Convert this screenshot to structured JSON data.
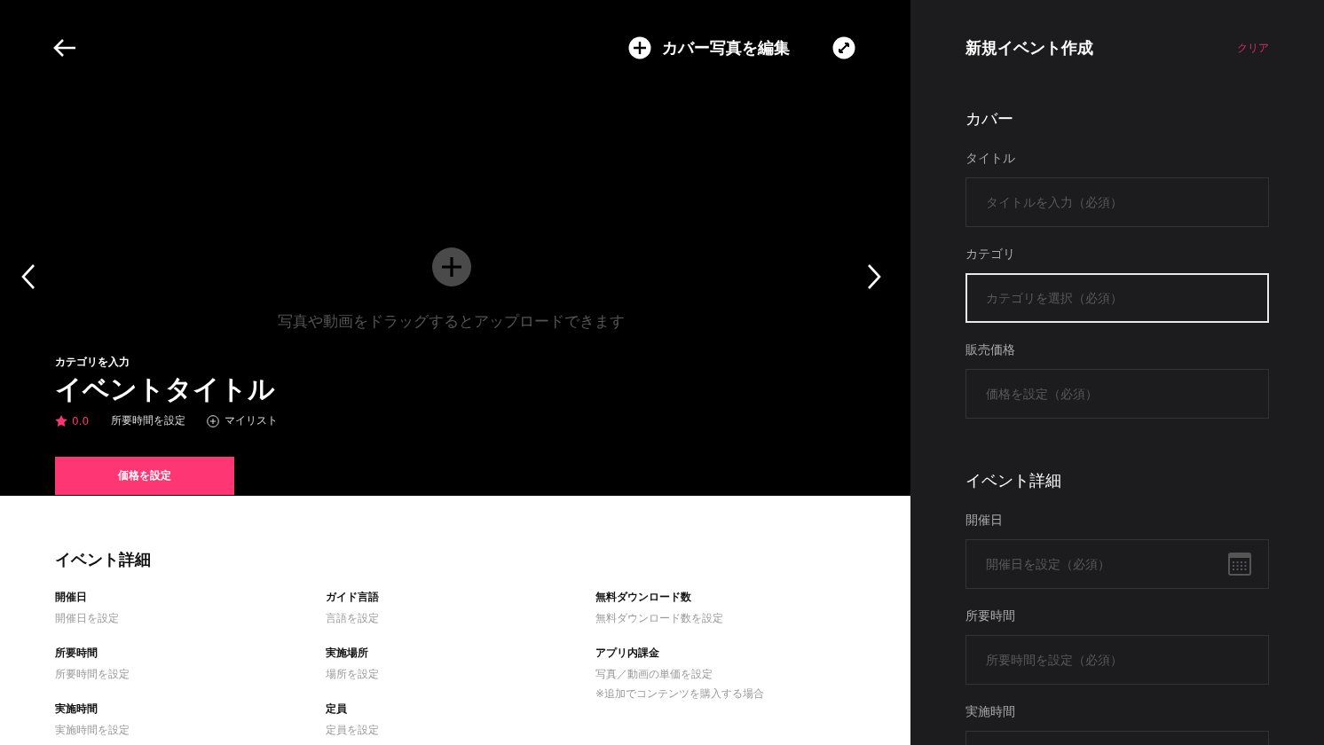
{
  "hero": {
    "edit_cover": "カバー写真を編集",
    "upload_hint": "写真や動画をドラッグするとアップロードできます",
    "category": "カテゴリを入力",
    "title": "イベントタイトル",
    "rating": "0.0",
    "duration": "所要時間を設定",
    "mylist": "マイリスト",
    "price_button": "価格を設定"
  },
  "details": {
    "title": "イベント詳細",
    "items": [
      {
        "label": "開催日",
        "value": "開催日を設定"
      },
      {
        "label": "ガイド言語",
        "value": "言語を設定"
      },
      {
        "label": "無料ダウンロード数",
        "value": "無料ダウンロード数を設定"
      },
      {
        "label": "所要時間",
        "value": "所要時間を設定"
      },
      {
        "label": "実施場所",
        "value": "場所を設定"
      },
      {
        "label": "アプリ内課金",
        "value": "写真／動画の単価を設定",
        "note": "※追加でコンテンツを購入する場合"
      },
      {
        "label": "実施時間",
        "value": "実施時間を設定"
      },
      {
        "label": "定員",
        "value": "定員を設定"
      }
    ]
  },
  "panel": {
    "title": "新規イベント作成",
    "clear": "クリア",
    "sections": [
      {
        "heading": "カバー",
        "fields": [
          {
            "label": "タイトル",
            "placeholder": "タイトルを入力（必須）",
            "kind": "text",
            "focused": false
          },
          {
            "label": "カテゴリ",
            "placeholder": "カテゴリを選択（必須）",
            "kind": "text",
            "focused": true
          },
          {
            "label": "販売価格",
            "placeholder": "価格を設定（必須）",
            "kind": "text",
            "focused": false
          }
        ]
      },
      {
        "heading": "イベント詳細",
        "fields": [
          {
            "label": "開催日",
            "placeholder": "開催日を設定（必須）",
            "kind": "date",
            "focused": false
          },
          {
            "label": "所要時間",
            "placeholder": "所要時間を設定（必須）",
            "kind": "text",
            "focused": false
          },
          {
            "label": "実施時間",
            "kind": "text",
            "focused": false
          }
        ]
      }
    ]
  }
}
